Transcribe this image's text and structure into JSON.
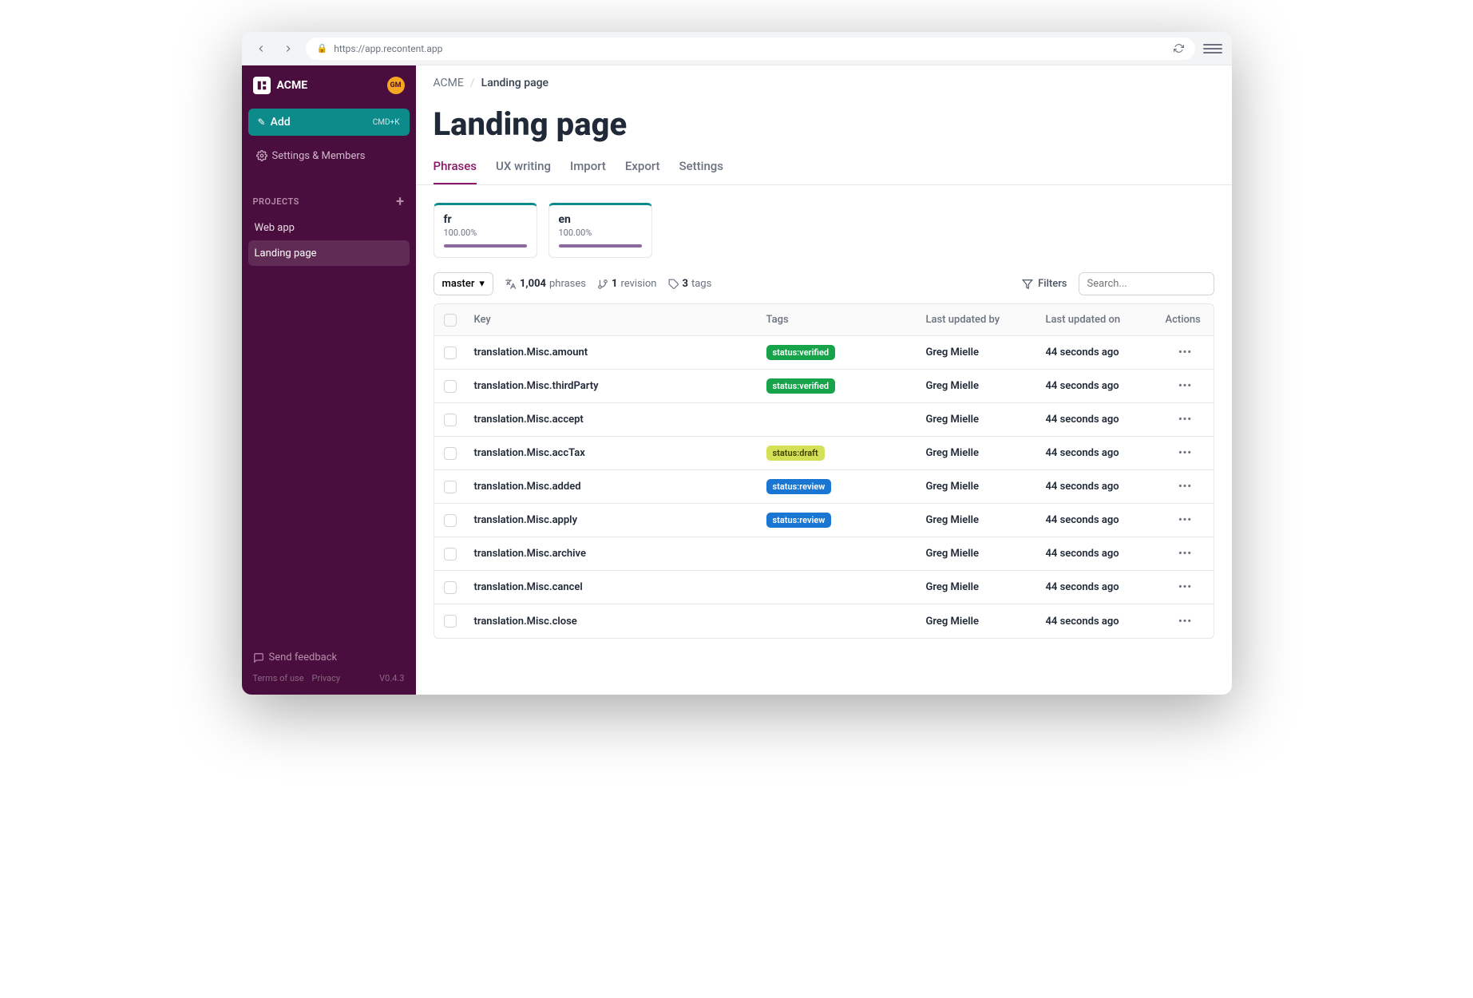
{
  "browser": {
    "url": "https://app.recontent.app"
  },
  "workspace": {
    "name": "ACME",
    "avatar": "GM"
  },
  "sidebar": {
    "add_label": "Add",
    "add_shortcut": "CMD+K",
    "settings_label": "Settings & Members",
    "projects_header": "PROJECTS",
    "projects": [
      {
        "label": "Web app",
        "active": false
      },
      {
        "label": "Landing page",
        "active": true
      }
    ],
    "feedback_label": "Send feedback",
    "terms_label": "Terms of use",
    "privacy_label": "Privacy",
    "version": "V0.4.3"
  },
  "breadcrumb": {
    "root": "ACME",
    "current": "Landing page"
  },
  "page_title": "Landing page",
  "tabs": [
    {
      "label": "Phrases",
      "active": true
    },
    {
      "label": "UX writing",
      "active": false
    },
    {
      "label": "Import",
      "active": false
    },
    {
      "label": "Export",
      "active": false
    },
    {
      "label": "Settings",
      "active": false
    }
  ],
  "languages": [
    {
      "code": "fr",
      "pct": "100.00%"
    },
    {
      "code": "en",
      "pct": "100.00%"
    }
  ],
  "toolbar": {
    "branch": "master",
    "phrases_count": "1,004",
    "phrases_label": "phrases",
    "revisions_count": "1",
    "revisions_label": "revision",
    "tags_count": "3",
    "tags_label": "tags",
    "filters_label": "Filters",
    "search_placeholder": "Search..."
  },
  "table": {
    "headers": {
      "key": "Key",
      "tags": "Tags",
      "updated_by": "Last updated by",
      "updated_on": "Last updated on",
      "actions": "Actions"
    },
    "rows": [
      {
        "key": "translation.Misc.amount",
        "tag": "status:verified",
        "tag_class": "tag-verified",
        "by": "Greg Mielle",
        "on": "44 seconds ago"
      },
      {
        "key": "translation.Misc.thirdParty",
        "tag": "status:verified",
        "tag_class": "tag-verified",
        "by": "Greg Mielle",
        "on": "44 seconds ago"
      },
      {
        "key": "translation.Misc.accept",
        "tag": "",
        "tag_class": "",
        "by": "Greg Mielle",
        "on": "44 seconds ago"
      },
      {
        "key": "translation.Misc.accTax",
        "tag": "status:draft",
        "tag_class": "tag-draft",
        "by": "Greg Mielle",
        "on": "44 seconds ago"
      },
      {
        "key": "translation.Misc.added",
        "tag": "status:review",
        "tag_class": "tag-review",
        "by": "Greg Mielle",
        "on": "44 seconds ago"
      },
      {
        "key": "translation.Misc.apply",
        "tag": "status:review",
        "tag_class": "tag-review",
        "by": "Greg Mielle",
        "on": "44 seconds ago"
      },
      {
        "key": "translation.Misc.archive",
        "tag": "",
        "tag_class": "",
        "by": "Greg Mielle",
        "on": "44 seconds ago"
      },
      {
        "key": "translation.Misc.cancel",
        "tag": "",
        "tag_class": "",
        "by": "Greg Mielle",
        "on": "44 seconds ago"
      },
      {
        "key": "translation.Misc.close",
        "tag": "",
        "tag_class": "",
        "by": "Greg Mielle",
        "on": "44 seconds ago"
      }
    ]
  }
}
